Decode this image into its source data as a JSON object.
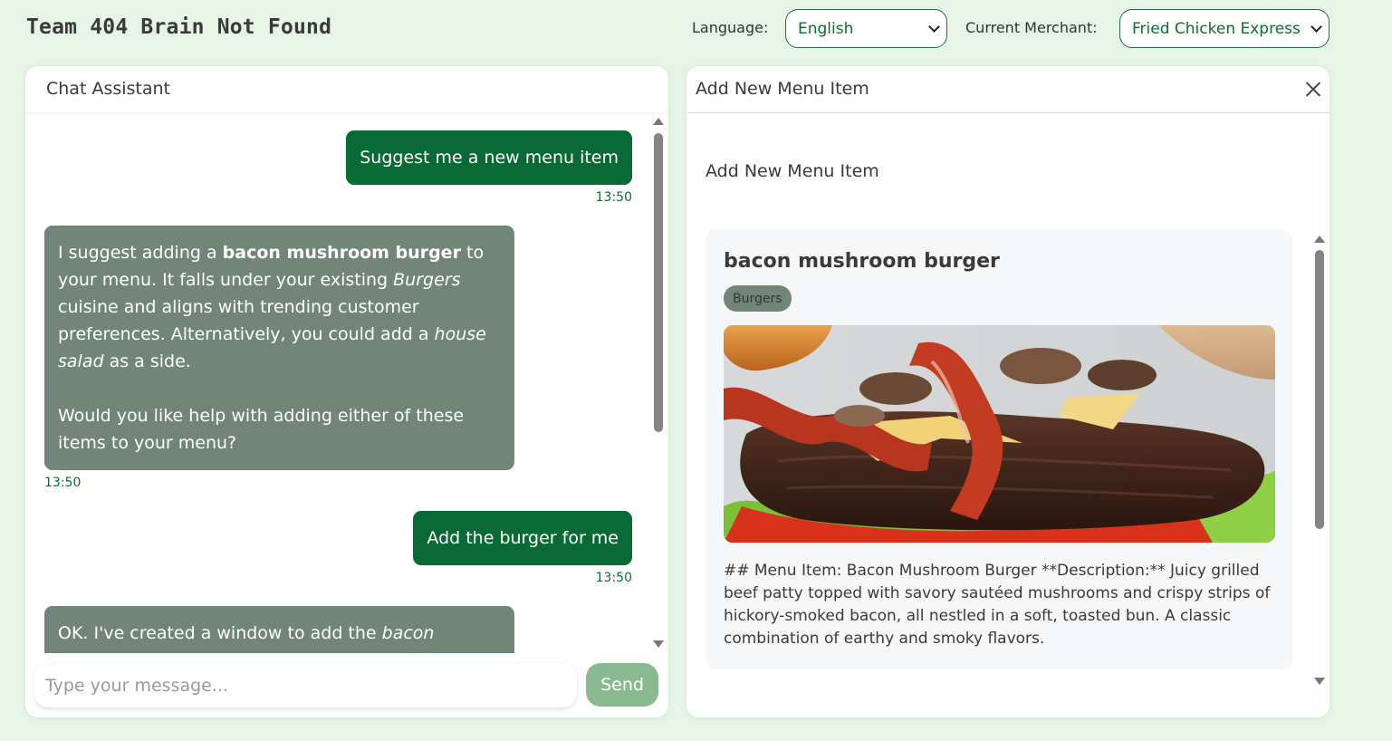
{
  "header": {
    "app_title": "Team 404 Brain Not Found",
    "language_label": "Language:",
    "language_value": "English",
    "merchant_label": "Current Merchant:",
    "merchant_value": "Fried Chicken Express"
  },
  "chat": {
    "title": "Chat Assistant",
    "messages": [
      {
        "role": "user",
        "text": "Suggest me a new menu item",
        "time": "13:50"
      },
      {
        "role": "assistant",
        "p1_a": "I suggest adding a ",
        "p1_bold": "bacon mushroom burger",
        "p1_b": " to your menu. It falls under your existing ",
        "p1_ital": "Burgers",
        "p1_c": " cuisine and aligns with trending customer preferences. Alternatively, you could add a ",
        "p1_ital2": "house salad",
        "p1_d": " as a side.",
        "p2": "Would you like help with adding either of these items to your menu?",
        "time": "13:50"
      },
      {
        "role": "user",
        "text": "Add the burger for me",
        "time": "13:50"
      },
      {
        "role": "assistant",
        "p1_a": "OK. I've created a window to add the ",
        "p1_ital": "bacon"
      }
    ],
    "input_placeholder": "Type your message...",
    "send_label": "Send"
  },
  "form": {
    "header_title": "Add New Menu Item",
    "subtitle": "Add New Menu Item",
    "item": {
      "name": "bacon mushroom burger",
      "tag": "Burgers",
      "image": "burger-photo",
      "description": "## Menu Item: Bacon Mushroom Burger **Description:** Juicy grilled beef patty topped with savory sautéed mushrooms and crispy strips of hickory-smoked bacon, all nestled in a soft, toasted bun. A classic combination of earthy and smoky flavors."
    }
  },
  "colors": {
    "page_bg": "#e6f4e6",
    "brand_green": "#0a6a36",
    "bot_bubble": "#718579",
    "send_button": "#8ab88f"
  },
  "icons": {
    "close": "close-icon",
    "dropdown": "chevron-down-icon",
    "scroll_up": "scroll-up-arrow-icon",
    "scroll_down": "scroll-down-arrow-icon"
  }
}
